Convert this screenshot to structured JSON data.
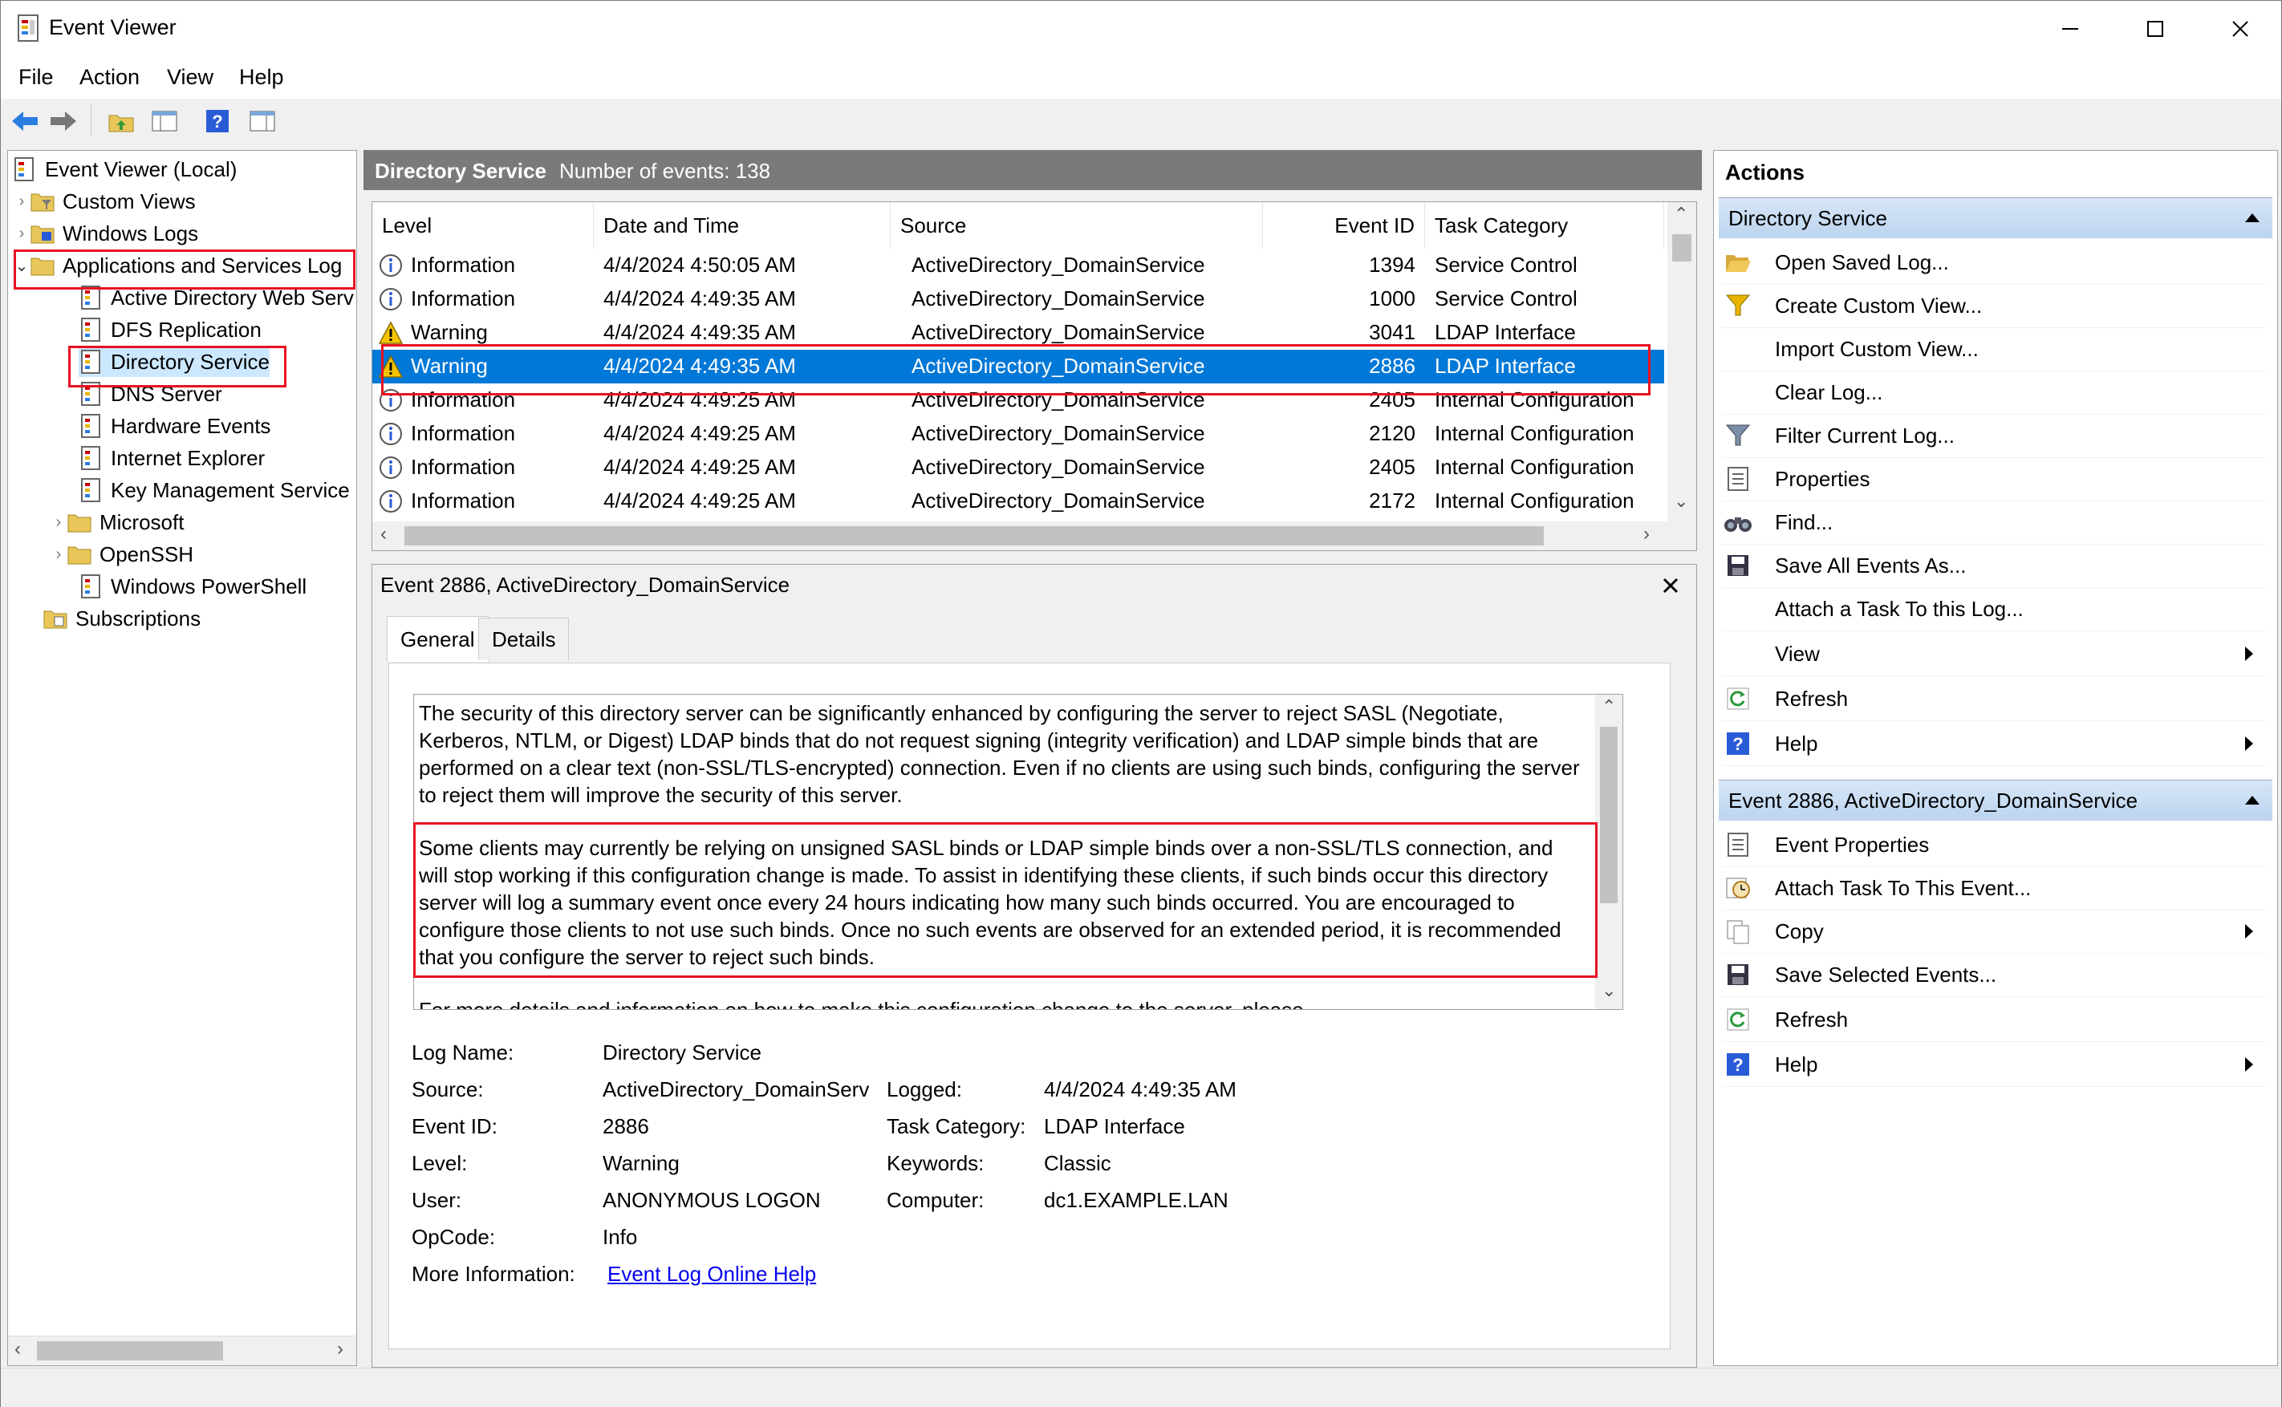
{
  "window": {
    "title": "Event Viewer"
  },
  "menu": [
    "File",
    "Action",
    "View",
    "Help"
  ],
  "tree": {
    "root": "Event Viewer (Local)",
    "custom_views": "Custom Views",
    "windows_logs": "Windows Logs",
    "apps_services": "Applications and Services Log",
    "children": [
      "Active Directory Web Serv",
      "DFS Replication",
      "Directory Service",
      "DNS Server",
      "Hardware Events",
      "Internet Explorer",
      "Key Management Service"
    ],
    "microsoft": "Microsoft",
    "openssh": "OpenSSH",
    "powershell": "Windows PowerShell",
    "subscriptions": "Subscriptions"
  },
  "log": {
    "name": "Directory Service",
    "count_text": "Number of events: 138",
    "columns": [
      "Level",
      "Date and Time",
      "Source",
      "Event ID",
      "Task Category"
    ],
    "rows": [
      {
        "level": "Information",
        "date": "4/4/2024 4:50:05 AM",
        "source": "ActiveDirectory_DomainService",
        "id": "1394",
        "task": "Service Control"
      },
      {
        "level": "Information",
        "date": "4/4/2024 4:49:35 AM",
        "source": "ActiveDirectory_DomainService",
        "id": "1000",
        "task": "Service Control"
      },
      {
        "level": "Warning",
        "date": "4/4/2024 4:49:35 AM",
        "source": "ActiveDirectory_DomainService",
        "id": "3041",
        "task": "LDAP Interface"
      },
      {
        "level": "Warning",
        "date": "4/4/2024 4:49:35 AM",
        "source": "ActiveDirectory_DomainService",
        "id": "2886",
        "task": "LDAP Interface"
      },
      {
        "level": "Information",
        "date": "4/4/2024 4:49:25 AM",
        "source": "ActiveDirectory_DomainService",
        "id": "2405",
        "task": "Internal Configuration"
      },
      {
        "level": "Information",
        "date": "4/4/2024 4:49:25 AM",
        "source": "ActiveDirectory_DomainService",
        "id": "2120",
        "task": "Internal Configuration"
      },
      {
        "level": "Information",
        "date": "4/4/2024 4:49:25 AM",
        "source": "ActiveDirectory_DomainService",
        "id": "2405",
        "task": "Internal Configuration"
      },
      {
        "level": "Information",
        "date": "4/4/2024 4:49:25 AM",
        "source": "ActiveDirectory_DomainService",
        "id": "2172",
        "task": "Internal Configuration"
      }
    ]
  },
  "detail": {
    "title": "Event 2886, ActiveDirectory_DomainService",
    "tabs": [
      "General",
      "Details"
    ],
    "para1": "The security of this directory server can be significantly enhanced by configuring the server to reject SASL (Negotiate, Kerberos, NTLM, or Digest) LDAP binds that do not request signing (integrity verification) and LDAP simple binds that are performed on a clear text (non-SSL/TLS-encrypted) connection.  Even if no clients are using such binds, configuring the server to reject them will improve the security of this server.",
    "para2": "Some clients may currently be relying on unsigned SASL binds or LDAP simple binds over a non-SSL/TLS connection, and will stop working if this configuration change is made.  To assist in identifying these clients, if such binds occur this directory server will log a summary event once every 24 hours indicating how many such binds occurred.  You are encouraged to configure those clients to not use such binds.  Once no such events are observed for an extended period, it is recommended that you configure the server to reject such binds.",
    "para3": "For more details and information on how to make this configuration change to the server, please",
    "props": {
      "log_name_label": "Log Name:",
      "log_name": "Directory Service",
      "source_label": "Source:",
      "source": "ActiveDirectory_DomainServic",
      "logged_label": "Logged:",
      "logged": "4/4/2024 4:49:35 AM",
      "event_id_label": "Event ID:",
      "event_id": "2886",
      "task_label": "Task Category:",
      "task": "LDAP Interface",
      "level_label": "Level:",
      "level": "Warning",
      "keywords_label": "Keywords:",
      "keywords": "Classic",
      "user_label": "User:",
      "user": "ANONYMOUS LOGON",
      "computer_label": "Computer:",
      "computer": "dc1.EXAMPLE.LAN",
      "opcode_label": "OpCode:",
      "opcode": "Info",
      "more_label": "More Information:",
      "more_link": "Event Log Online Help"
    }
  },
  "actions": {
    "title": "Actions",
    "section1": "Directory Service",
    "items1": [
      "Open Saved Log...",
      "Create Custom View...",
      "Import Custom View...",
      "Clear Log...",
      "Filter Current Log...",
      "Properties",
      "Find...",
      "Save All Events As...",
      "Attach a Task To this Log...",
      "View",
      "Refresh",
      "Help"
    ],
    "section2": "Event 2886, ActiveDirectory_DomainService",
    "items2": [
      "Event Properties",
      "Attach Task To This Event...",
      "Copy",
      "Save Selected Events...",
      "Refresh",
      "Help"
    ]
  },
  "colors": {
    "selection": "#0078d7",
    "highlight_box": "#e81123",
    "link": "#0000ee"
  }
}
